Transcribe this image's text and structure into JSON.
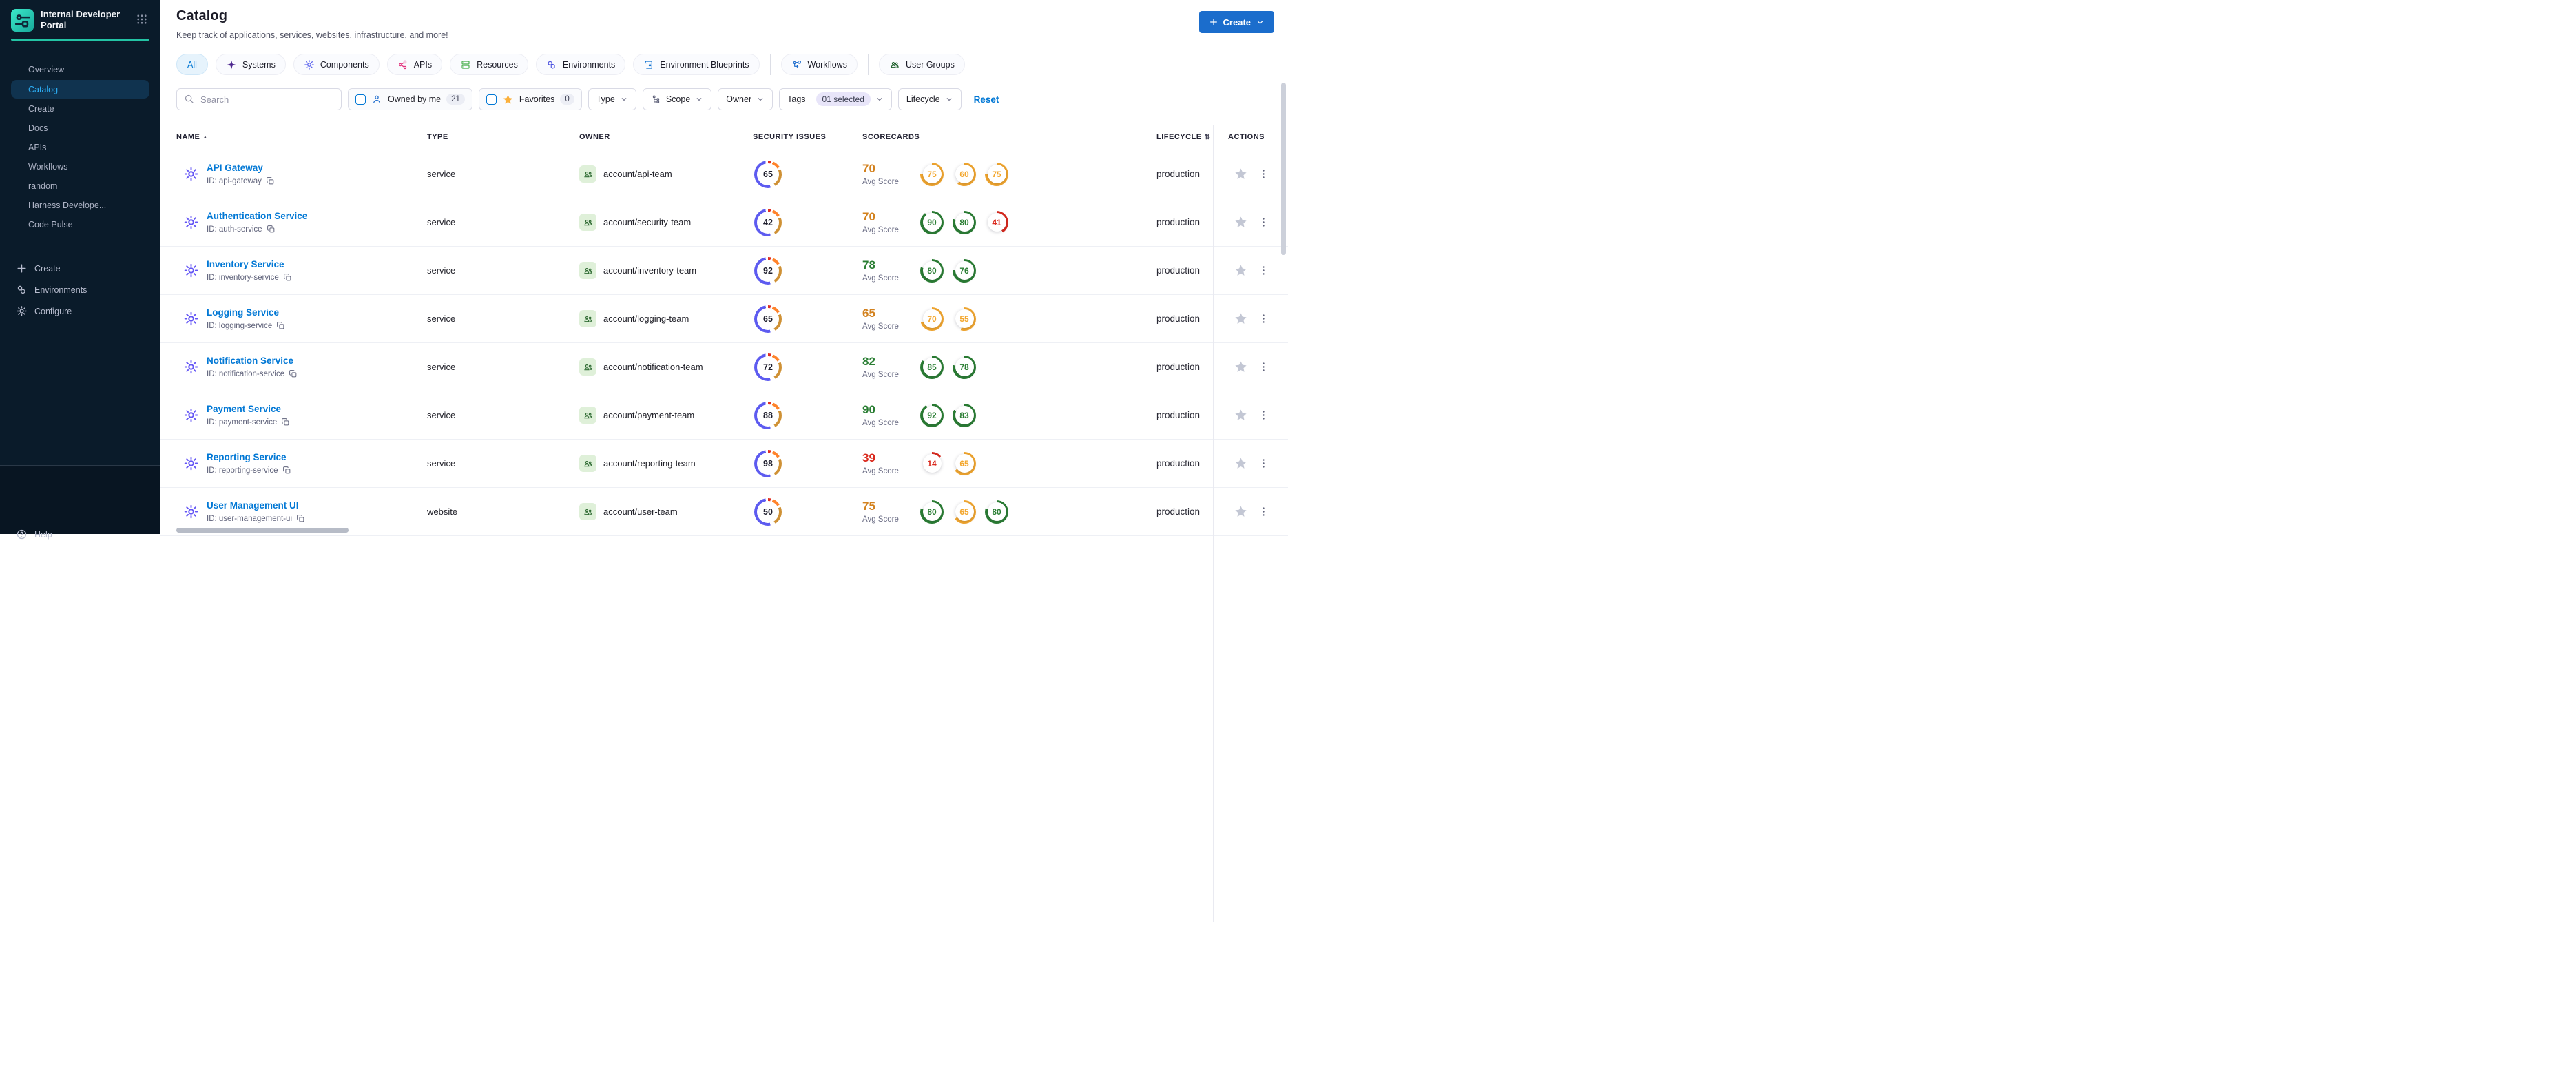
{
  "brand": {
    "title": "Internal Developer Portal"
  },
  "sidebar": {
    "items": [
      {
        "label": "Overview",
        "active": false
      },
      {
        "label": "Catalog",
        "active": true
      },
      {
        "label": "Create",
        "active": false
      },
      {
        "label": "Docs",
        "active": false
      },
      {
        "label": "APIs",
        "active": false
      },
      {
        "label": "Workflows",
        "active": false
      },
      {
        "label": "random",
        "active": false
      },
      {
        "label": "Harness Develope...",
        "active": false
      },
      {
        "label": "Code Pulse",
        "active": false
      }
    ],
    "bottom_items": [
      {
        "label": "Create",
        "icon": "plus"
      },
      {
        "label": "Environments",
        "icon": "hexagons"
      },
      {
        "label": "Configure",
        "icon": "gear"
      }
    ],
    "help_label": "Help"
  },
  "header": {
    "title": "Catalog",
    "subtitle": "Keep track of applications, services, websites, infrastructure, and more!",
    "create_label": "Create"
  },
  "tabs": [
    {
      "label": "All",
      "icon": null,
      "icon_color": null,
      "active": true,
      "divider_before": false
    },
    {
      "label": "Systems",
      "icon": "star4",
      "icon_color": "#4d278f",
      "active": false,
      "divider_before": false
    },
    {
      "label": "Components",
      "icon": "gear",
      "icon_color": "#5b63ee",
      "active": false,
      "divider_before": false
    },
    {
      "label": "APIs",
      "icon": "share",
      "icon_color": "#e3347e",
      "active": false,
      "divider_before": false
    },
    {
      "label": "Resources",
      "icon": "server",
      "icon_color": "#42ab45",
      "active": false,
      "divider_before": false
    },
    {
      "label": "Environments",
      "icon": "hexagons",
      "icon_color": "#4c52e0",
      "active": false,
      "divider_before": false
    },
    {
      "label": "Environment Blueprints",
      "icon": "blueprint",
      "icon_color": "#0b6fd0",
      "active": false,
      "divider_before": false
    },
    {
      "label": "Workflows",
      "icon": "flow",
      "icon_color": "#1a6acc",
      "active": false,
      "divider_before": true
    },
    {
      "label": "User Groups",
      "icon": "people",
      "icon_color": "#1c5e2a",
      "active": false,
      "divider_before": true
    }
  ],
  "filters": {
    "search_placeholder": "Search",
    "owned_label": "Owned by me",
    "owned_count": "21",
    "favorites_label": "Favorites",
    "favorites_count": "0",
    "type_label": "Type",
    "scope_label": "Scope",
    "owner_label": "Owner",
    "tags_label": "Tags",
    "tags_selected": "01 selected",
    "lifecycle_label": "Lifecycle",
    "reset_label": "Reset"
  },
  "table": {
    "columns": [
      {
        "label": "NAME",
        "sort": "asc"
      },
      {
        "label": "TYPE",
        "sort": null
      },
      {
        "label": "OWNER",
        "sort": null
      },
      {
        "label": "SECURITY ISSUES",
        "sort": null
      },
      {
        "label": "SCORECARDS",
        "sort": null
      },
      {
        "label": "LIFECYCLE",
        "sort": "both"
      },
      {
        "label": "ACTIONS",
        "sort": null
      }
    ],
    "id_prefix": "ID:",
    "avg_caption": "Avg Score",
    "rows": [
      {
        "name": "API Gateway",
        "id": "api-gateway",
        "type": "service",
        "owner": "account/api-team",
        "security_issues": 65,
        "avg_score": 70,
        "avg_color": "orange",
        "scorecards": [
          {
            "value": 75,
            "color": "orange"
          },
          {
            "value": 60,
            "color": "orange"
          },
          {
            "value": 75,
            "color": "orange"
          }
        ],
        "lifecycle": "production"
      },
      {
        "name": "Authentication Service",
        "id": "auth-service",
        "type": "service",
        "owner": "account/security-team",
        "security_issues": 42,
        "avg_score": 70,
        "avg_color": "orange",
        "scorecards": [
          {
            "value": 90,
            "color": "green"
          },
          {
            "value": 80,
            "color": "green"
          },
          {
            "value": 41,
            "color": "red"
          }
        ],
        "lifecycle": "production"
      },
      {
        "name": "Inventory Service",
        "id": "inventory-service",
        "type": "service",
        "owner": "account/inventory-team",
        "security_issues": 92,
        "avg_score": 78,
        "avg_color": "green",
        "scorecards": [
          {
            "value": 80,
            "color": "green"
          },
          {
            "value": 76,
            "color": "green"
          }
        ],
        "lifecycle": "production"
      },
      {
        "name": "Logging Service",
        "id": "logging-service",
        "type": "service",
        "owner": "account/logging-team",
        "security_issues": 65,
        "avg_score": 65,
        "avg_color": "orange",
        "scorecards": [
          {
            "value": 70,
            "color": "orange"
          },
          {
            "value": 55,
            "color": "orange"
          }
        ],
        "lifecycle": "production"
      },
      {
        "name": "Notification Service",
        "id": "notification-service",
        "type": "service",
        "owner": "account/notification-team",
        "security_issues": 72,
        "avg_score": 82,
        "avg_color": "green",
        "scorecards": [
          {
            "value": 85,
            "color": "green"
          },
          {
            "value": 78,
            "color": "green"
          }
        ],
        "lifecycle": "production"
      },
      {
        "name": "Payment Service",
        "id": "payment-service",
        "type": "service",
        "owner": "account/payment-team",
        "security_issues": 88,
        "avg_score": 90,
        "avg_color": "green",
        "scorecards": [
          {
            "value": 92,
            "color": "green"
          },
          {
            "value": 83,
            "color": "green"
          }
        ],
        "lifecycle": "production"
      },
      {
        "name": "Reporting Service",
        "id": "reporting-service",
        "type": "service",
        "owner": "account/reporting-team",
        "security_issues": 98,
        "avg_score": 39,
        "avg_color": "red",
        "scorecards": [
          {
            "value": 14,
            "color": "red"
          },
          {
            "value": 65,
            "color": "orange"
          }
        ],
        "lifecycle": "production"
      },
      {
        "name": "User Management UI",
        "id": "user-management-ui",
        "type": "website",
        "owner": "account/user-team",
        "security_issues": 50,
        "avg_score": 75,
        "avg_color": "orange",
        "scorecards": [
          {
            "value": 80,
            "color": "green"
          },
          {
            "value": 65,
            "color": "orange"
          },
          {
            "value": 80,
            "color": "green"
          }
        ],
        "lifecycle": "production"
      }
    ]
  },
  "colors": {
    "accent_blue": "#0278d5",
    "button_blue": "#1b6dcc",
    "teal": "#23c3a4",
    "score_green": "#2a7e33",
    "score_orange": "#f3a72e",
    "score_red": "#da291d",
    "donut_blue": "#5d5bf0",
    "donut_orange": "#ff832b",
    "donut_amber": "#cf9135",
    "donut_red": "#e02f22"
  }
}
